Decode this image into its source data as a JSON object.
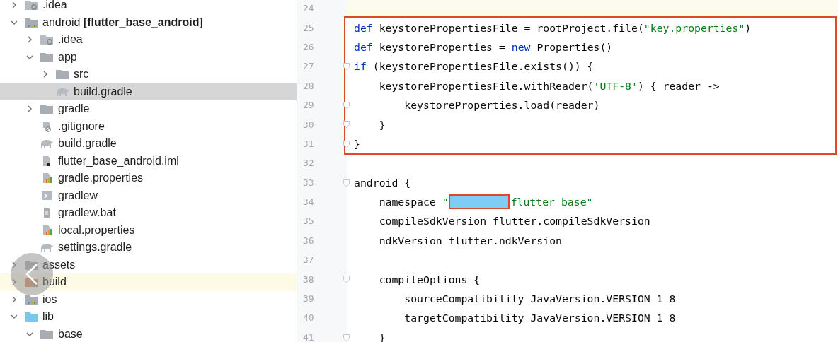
{
  "project_tree": [
    {
      "name": ".idea",
      "kind": "config-folder",
      "expanded": false,
      "selected": false,
      "highlighted": false
    },
    {
      "name": "android **[flutter_base_android]**",
      "kind": "module-folder",
      "expanded": true,
      "selected": false,
      "highlighted": false,
      "children": [
        {
          "name": ".idea",
          "kind": "config-folder",
          "expanded": false,
          "selected": false,
          "highlighted": false
        },
        {
          "name": "app",
          "kind": "folder",
          "expanded": true,
          "selected": false,
          "highlighted": false,
          "children": [
            {
              "name": "src",
              "kind": "folder",
              "expanded": false,
              "selected": false,
              "highlighted": false
            },
            {
              "name": "build.gradle",
              "kind": "gradle",
              "selected": true,
              "highlighted": false
            }
          ]
        },
        {
          "name": "gradle",
          "kind": "folder",
          "expanded": false,
          "selected": false,
          "highlighted": false
        },
        {
          "name": ".gitignore",
          "kind": "ignore",
          "selected": false,
          "highlighted": false
        },
        {
          "name": "build.gradle",
          "kind": "gradle",
          "selected": false,
          "highlighted": false
        },
        {
          "name": "flutter_base_android.iml",
          "kind": "iml",
          "selected": false,
          "highlighted": false
        },
        {
          "name": "gradle.properties",
          "kind": "properties",
          "selected": false,
          "highlighted": false
        },
        {
          "name": "gradlew",
          "kind": "shell",
          "selected": false,
          "highlighted": false
        },
        {
          "name": "gradlew.bat",
          "kind": "bat",
          "selected": false,
          "highlighted": false
        },
        {
          "name": "local.properties",
          "kind": "properties",
          "selected": false,
          "highlighted": false
        },
        {
          "name": "settings.gradle",
          "kind": "gradle",
          "selected": false,
          "highlighted": false
        }
      ]
    },
    {
      "name": "assets",
      "kind": "folder",
      "expanded": false,
      "selected": false,
      "highlighted": false
    },
    {
      "name": "build",
      "kind": "excluded-folder",
      "expanded": false,
      "selected": false,
      "highlighted": true
    },
    {
      "name": "ios",
      "kind": "module-folder",
      "expanded": false,
      "selected": false,
      "highlighted": false
    },
    {
      "name": "lib",
      "kind": "source-folder",
      "expanded": true,
      "selected": false,
      "highlighted": false,
      "children": [
        {
          "name": "base",
          "kind": "folder",
          "expanded": true,
          "selected": false,
          "highlighted": false
        }
      ]
    }
  ],
  "editor": {
    "sections": [
      {
        "kind": "plain",
        "lines": [
          {
            "number": "24",
            "current": true,
            "fold": false
          }
        ]
      },
      {
        "kind": "annotated",
        "lines": [
          {
            "number": "25",
            "current": false,
            "fold": false,
            "tokens": [
              {
                "kind": "keyword",
                "text": "def"
              },
              {
                "kind": "plain",
                "text": " keystorePropertiesFile = rootProject.file("
              },
              {
                "kind": "string",
                "text": "\"key.properties\""
              },
              {
                "kind": "plain",
                "text": ")"
              }
            ]
          },
          {
            "number": "26",
            "current": false,
            "fold": false,
            "tokens": [
              {
                "kind": "keyword",
                "text": "def"
              },
              {
                "kind": "plain",
                "text": " keystoreProperties = "
              },
              {
                "kind": "keyword",
                "text": "new"
              },
              {
                "kind": "plain",
                "text": " Properties()"
              }
            ]
          },
          {
            "number": "27",
            "current": false,
            "fold": true,
            "tokens": [
              {
                "kind": "keyword",
                "text": "if"
              },
              {
                "kind": "plain",
                "text": " (keystorePropertiesFile.exists()) {"
              }
            ]
          },
          {
            "number": "28",
            "current": false,
            "fold": false,
            "tokens": [
              {
                "kind": "plain",
                "text": "    keystorePropertiesFile.withReader("
              },
              {
                "kind": "string",
                "text": "'UTF-8'"
              },
              {
                "kind": "plain",
                "text": ") { reader ->"
              }
            ]
          },
          {
            "number": "29",
            "current": false,
            "fold": true,
            "tokens": [
              {
                "kind": "plain",
                "text": "        keystoreProperties.load(reader)"
              }
            ]
          },
          {
            "number": "30",
            "current": false,
            "fold": true,
            "tokens": [
              {
                "kind": "plain",
                "text": "    }"
              }
            ]
          },
          {
            "number": "31",
            "current": false,
            "fold": true,
            "tokens": [
              {
                "kind": "plain",
                "text": "}"
              }
            ]
          }
        ]
      },
      {
        "kind": "plain",
        "lines": [
          {
            "number": "32",
            "current": false,
            "fold": false
          },
          {
            "number": "33",
            "current": false,
            "fold": true,
            "tokens": [
              {
                "kind": "plain",
                "text": "android {"
              }
            ]
          },
          {
            "number": "34",
            "current": false,
            "fold": false,
            "tokens": [
              {
                "kind": "plain",
                "text": "    namespace "
              },
              {
                "kind": "string",
                "text": "\""
              },
              {
                "kind": "redacted"
              },
              {
                "kind": "string",
                "text": "flutter_base\""
              }
            ]
          },
          {
            "number": "35",
            "current": false,
            "fold": false,
            "tokens": [
              {
                "kind": "plain",
                "text": "    compileSdkVersion flutter.compileSdkVersion"
              }
            ]
          },
          {
            "number": "36",
            "current": false,
            "fold": false,
            "tokens": [
              {
                "kind": "plain",
                "text": "    ndkVersion flutter.ndkVersion"
              }
            ]
          },
          {
            "number": "37",
            "current": false,
            "fold": false
          },
          {
            "number": "38",
            "current": false,
            "fold": true,
            "tokens": [
              {
                "kind": "plain",
                "text": "    compileOptions {"
              }
            ]
          },
          {
            "number": "39",
            "current": false,
            "fold": false,
            "tokens": [
              {
                "kind": "plain",
                "text": "        sourceCompatibility JavaVersion.VERSION_1_8"
              }
            ]
          },
          {
            "number": "40",
            "current": false,
            "fold": false,
            "tokens": [
              {
                "kind": "plain",
                "text": "        targetCompatibility JavaVersion.VERSION_1_8"
              }
            ]
          },
          {
            "number": "41",
            "current": false,
            "fold": true,
            "tokens": [
              {
                "kind": "plain",
                "text": "    }"
              }
            ]
          }
        ]
      }
    ]
  }
}
